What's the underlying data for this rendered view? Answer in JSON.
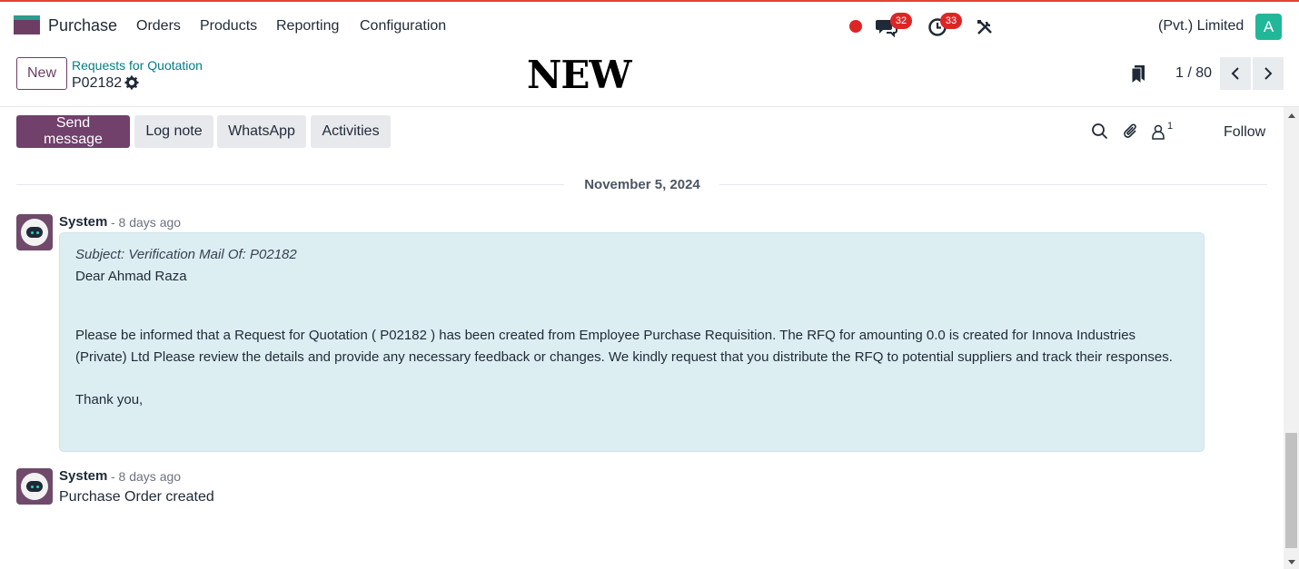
{
  "navbar": {
    "app_name": "Purchase",
    "menu": [
      "Orders",
      "Products",
      "Reporting",
      "Configuration"
    ],
    "messages_count": "32",
    "activities_count": "33",
    "company": "(Pvt.) Limited",
    "user_initial": "A"
  },
  "control": {
    "new_label": "New",
    "breadcrumb": "Requests for Quotation",
    "record_id": "P02182",
    "status_stamp": "NEW",
    "pager": "1 / 80"
  },
  "chatter": {
    "send_message": "Send message",
    "log_note": "Log note",
    "whatsapp": "WhatsApp",
    "activities": "Activities",
    "followers_count": "1",
    "follow": "Follow",
    "date_separator": "November 5, 2024",
    "messages": [
      {
        "author": "System",
        "time": "- 8 days ago",
        "subject": "Subject: Verification Mail Of: P02182",
        "greeting": "Dear Ahmad Raza",
        "body": "Please be informed that a Request for Quotation ( P02182 ) has been created from Employee Purchase Requisition. The RFQ for amounting 0.0 is created for Innova Industries (Private) Ltd Please review the details and provide any necessary feedback or changes. We kindly request that you distribute the RFQ to potential suppliers and track their responses.",
        "closing": "Thank you,"
      },
      {
        "author": "System",
        "time": "- 8 days ago",
        "body": "Purchase Order created"
      }
    ]
  },
  "colors": {
    "primary": "#71406b",
    "accent_teal": "#017e84",
    "badge_red": "#dc2626",
    "bubble_bg": "#ddeef2"
  }
}
